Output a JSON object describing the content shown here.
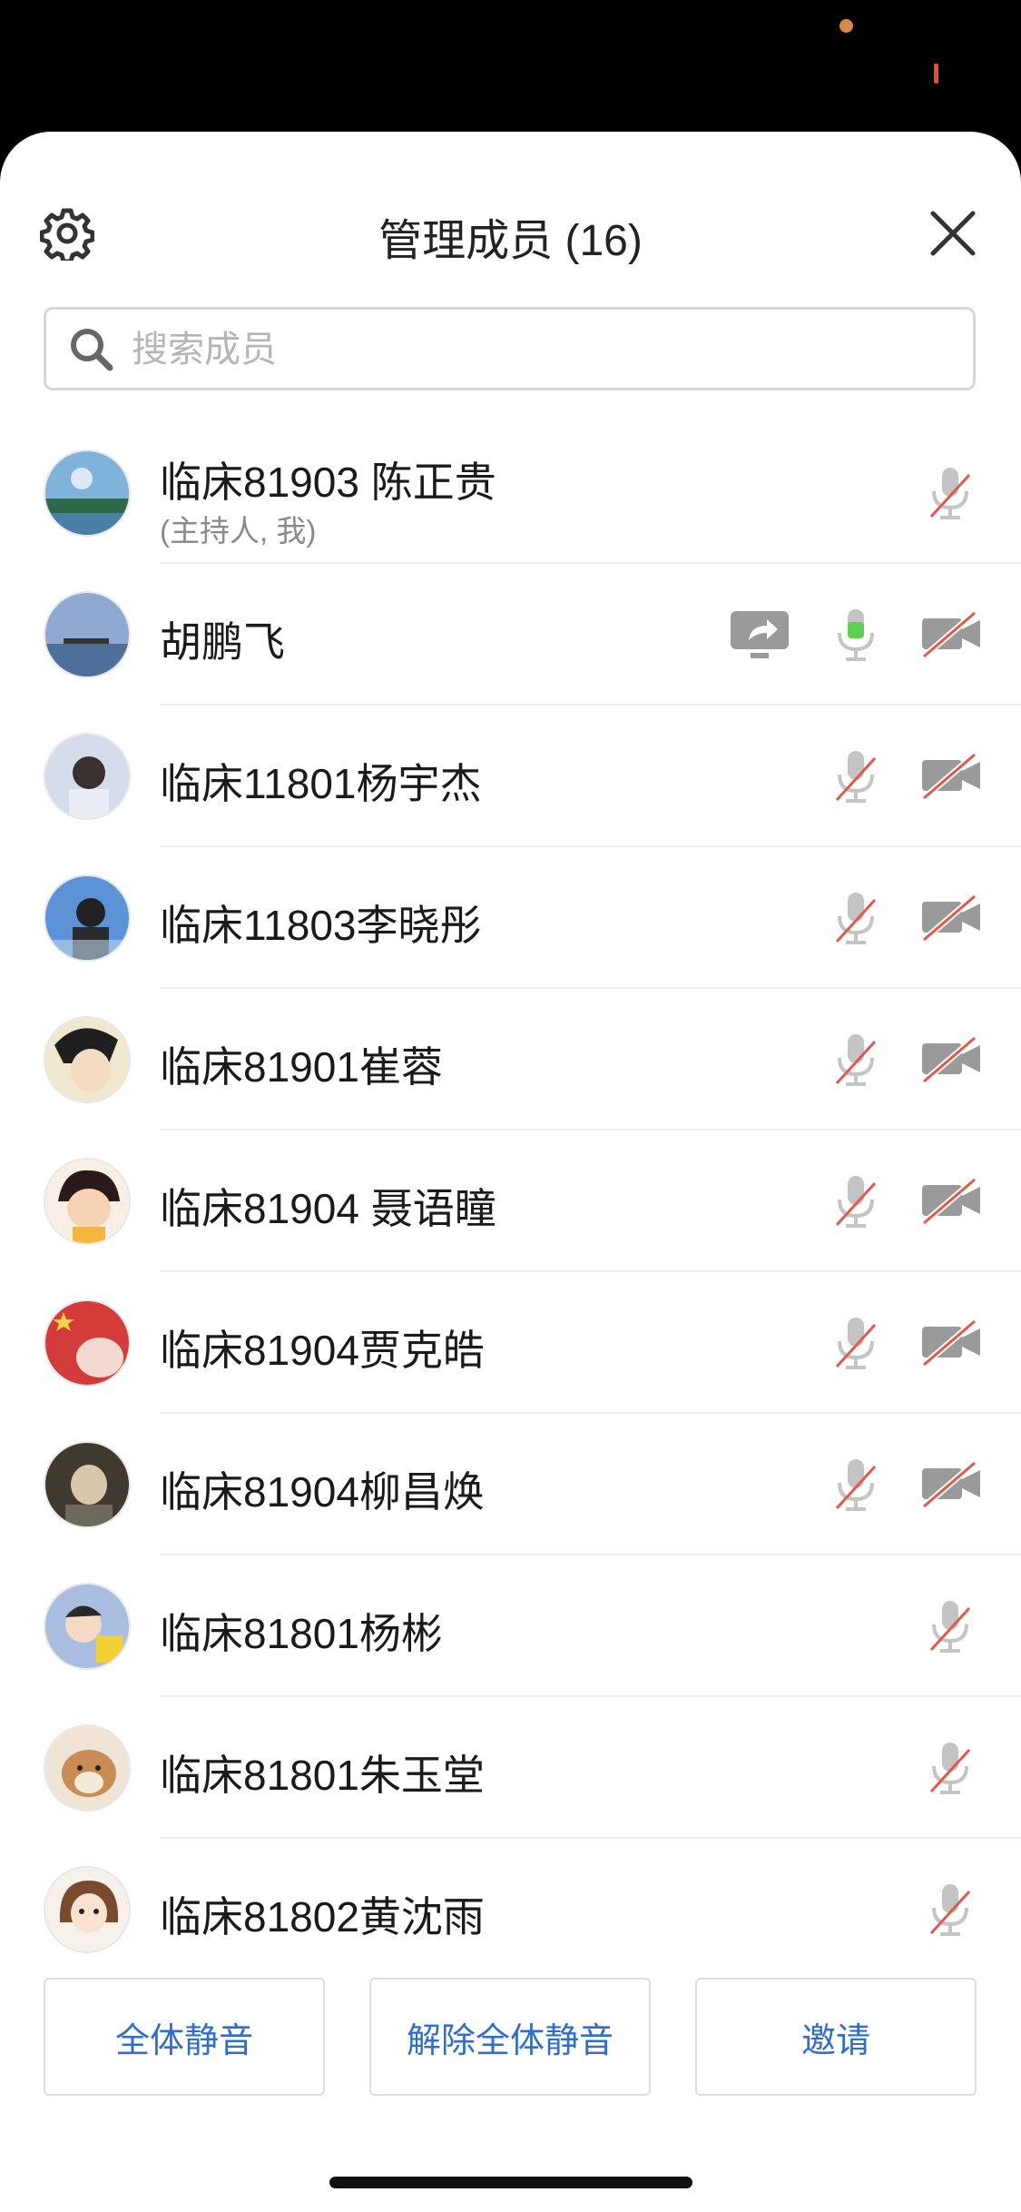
{
  "header": {
    "title": "管理成员 (16)"
  },
  "search": {
    "placeholder": "搜索成员"
  },
  "members": [
    {
      "name": "临床81903 陈正贵",
      "sub": "(主持人, 我)",
      "avatar_color": "#6aa2cc",
      "icons": [
        "mic-muted"
      ]
    },
    {
      "name": "胡鹏飞",
      "avatar_color": "#7f9fc8",
      "icons": [
        "screen-share",
        "mic-active",
        "camera-off"
      ]
    },
    {
      "name": "临床11801杨宇杰",
      "avatar_color": "#c3cde0",
      "icons": [
        "mic-muted",
        "camera-off"
      ]
    },
    {
      "name": "临床11803李晓彤",
      "avatar_color": "#4b82c9",
      "icons": [
        "mic-muted",
        "camera-off"
      ]
    },
    {
      "name": "临床81901崔蓉",
      "avatar_color": "#e9e2c9",
      "icons": [
        "mic-muted",
        "camera-off"
      ]
    },
    {
      "name": "临床81904 聂语瞳",
      "avatar_color": "#f0c9a6",
      "icons": [
        "mic-muted",
        "camera-off"
      ]
    },
    {
      "name": "临床81904贾克皓",
      "avatar_color": "#d84a4a",
      "icons": [
        "mic-muted",
        "camera-off"
      ]
    },
    {
      "name": "临床81904柳昌焕",
      "avatar_color": "#5d5a4e",
      "icons": [
        "mic-muted",
        "camera-off"
      ]
    },
    {
      "name": "临床81801杨彬",
      "avatar_color": "#9fb3d8",
      "icons": [
        "mic-muted"
      ]
    },
    {
      "name": "临床81801朱玉堂",
      "avatar_color": "#c99a6a",
      "icons": [
        "mic-muted"
      ]
    },
    {
      "name": "临床81802黄沈雨",
      "avatar_color": "#f1e6de",
      "icons": [
        "mic-muted"
      ]
    }
  ],
  "actions": {
    "mute_all": "全体静音",
    "unmute_all": "解除全体静音",
    "invite": "邀请"
  },
  "colors": {
    "accent": "#2f6fcb",
    "mute_slash": "#e05a4a",
    "mic_active": "#5fcf52"
  }
}
